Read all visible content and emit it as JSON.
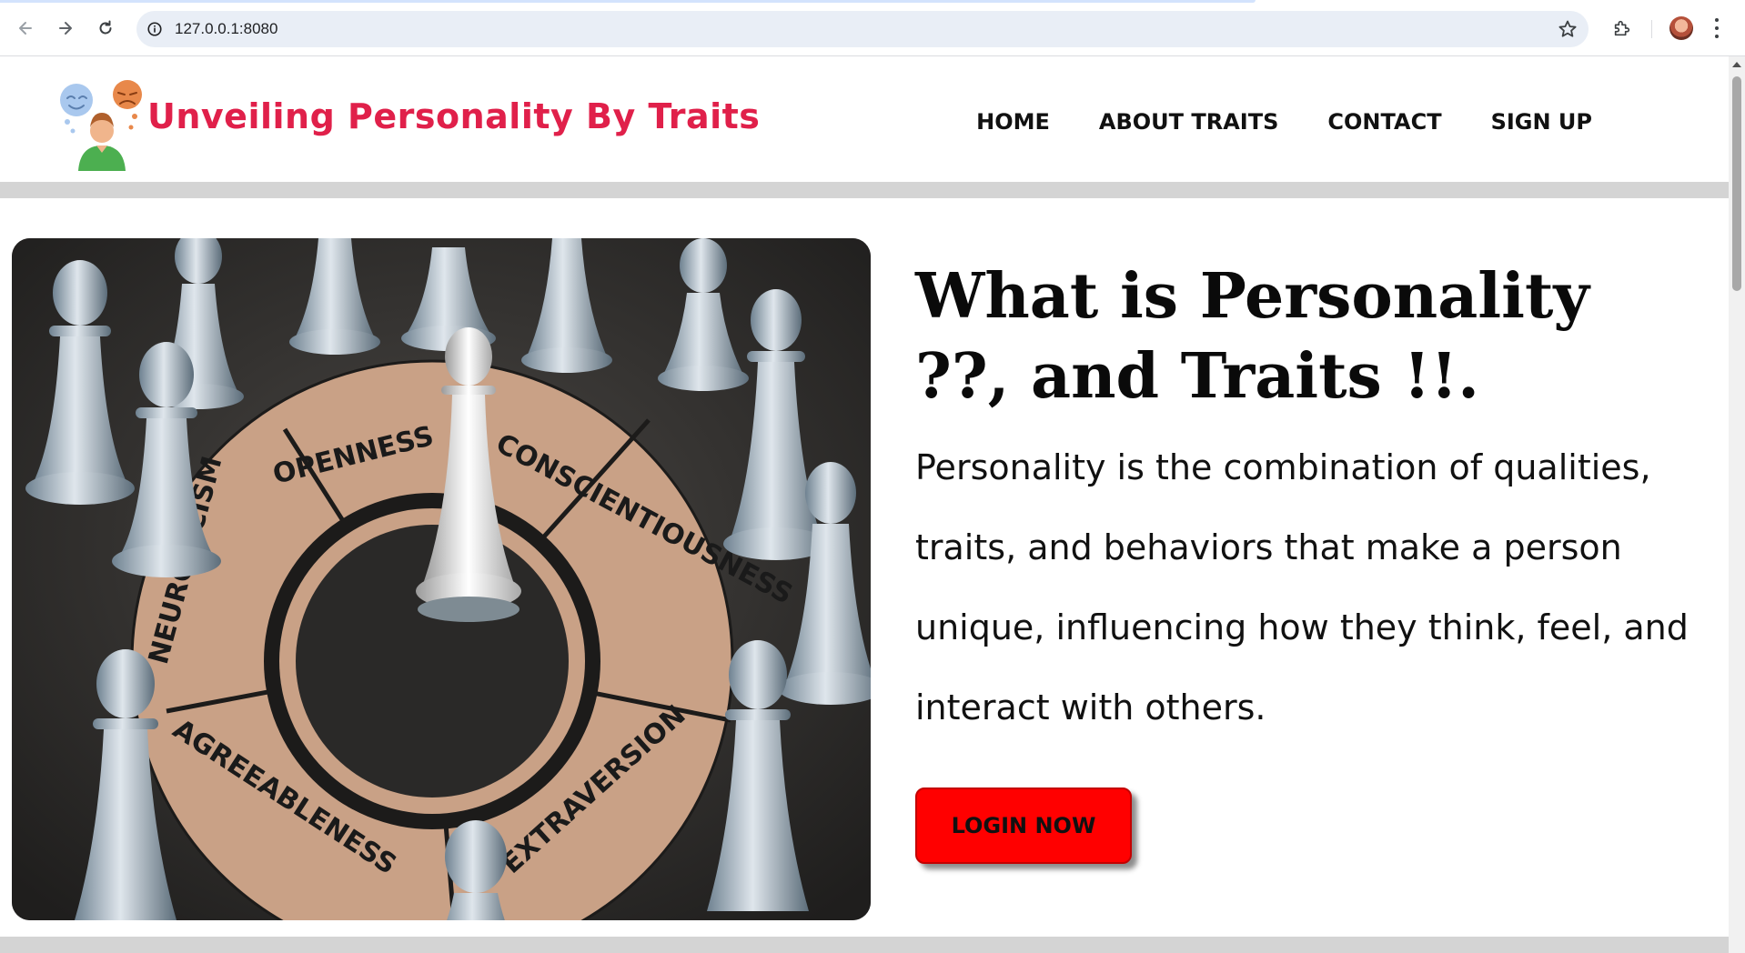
{
  "browser": {
    "url": "127.0.0.1:8080",
    "icons": [
      "back-arrow-icon",
      "forward-arrow-icon",
      "reload-icon",
      "site-info-icon",
      "bookmark-star-icon",
      "extensions-puzzle-icon",
      "profile-avatar",
      "more-menu-icon"
    ]
  },
  "site": {
    "title": "Unveiling Personality By Traits",
    "title_color": "#e0204a",
    "nav": [
      {
        "label": "HOME"
      },
      {
        "label": "ABOUT TRAITS"
      },
      {
        "label": "CONTACT"
      },
      {
        "label": "SIGN UP"
      }
    ]
  },
  "hero": {
    "heading": "What is Personality ??, and Traits !!.",
    "description": "Personality is the combination of qualities, traits, and behaviors that make a person unique, influencing how they think, feel, and interact with others.",
    "button_label": "LOGIN NOW",
    "button_color": "#ff0000",
    "image_labels": [
      "OPENNESS",
      "CONSCIENTIOUSNESS",
      "EXTRAVERSION",
      "AGREEABLENESS",
      "NEUROTICISM"
    ]
  }
}
